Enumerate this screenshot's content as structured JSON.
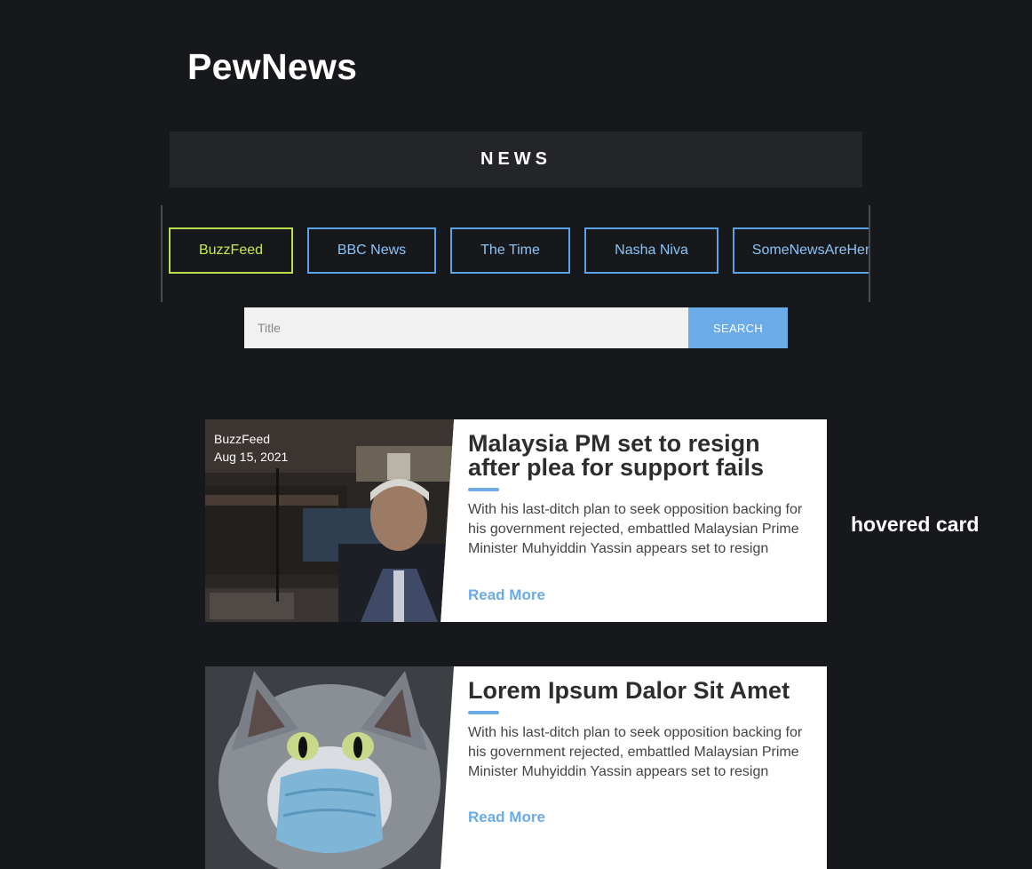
{
  "app": {
    "title": "PewNews"
  },
  "nav": {
    "label": "NEWS"
  },
  "sources": [
    {
      "label": "BuzzFeed",
      "active": true
    },
    {
      "label": "BBC News"
    },
    {
      "label": "The Time"
    },
    {
      "label": "Nasha Niva"
    },
    {
      "label": "SomeNewsAreHere"
    }
  ],
  "search": {
    "placeholder": "Title",
    "value": "",
    "button": "SEARCH"
  },
  "cards": [
    {
      "source": "BuzzFeed",
      "date": "Aug 15, 2021",
      "title": "Malaysia PM set to resign after plea for support fails",
      "summary": "With his last-ditch plan to seek opposition backing for his government rejected, embattled Malaysian Prime Minister Muhyiddin Yassin appears set to resign",
      "link": "Read More"
    },
    {
      "title": "Lorem Ipsum Dalor Sit Amet",
      "summary": "With his last-ditch plan to seek opposition backing for his government rejected, embattled Malaysian Prime Minister Muhyiddin Yassin appears set to resign",
      "link": "Read More"
    }
  ],
  "annotation": "hovered card",
  "colors": {
    "background": "#17181c",
    "accent": "#6aabe8",
    "active": "#c4ec4e"
  }
}
